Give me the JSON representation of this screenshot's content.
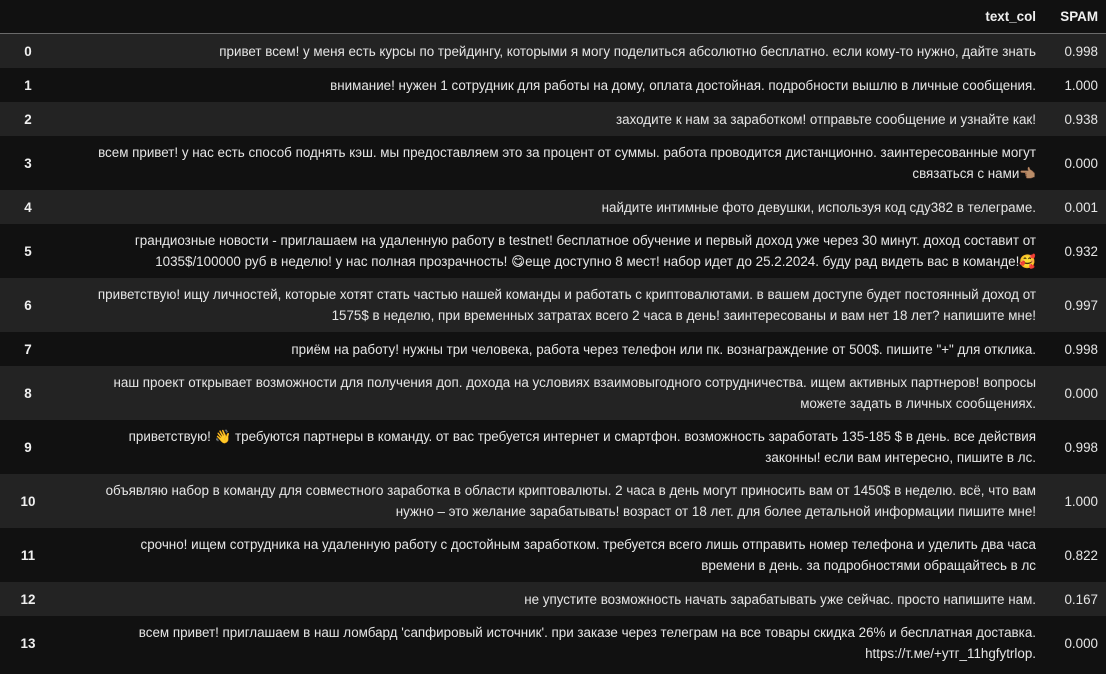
{
  "table": {
    "columns": [
      "",
      "text_col",
      "SPAM"
    ],
    "rows": [
      {
        "index": "0",
        "text": "привет всем! у меня есть курсы по трейдингу, которыми я могу поделиться абсолютно бесплатно. если кому-то нужно, дайте знать",
        "spam": "0.998"
      },
      {
        "index": "1",
        "text": "внимание! нужен 1 сотрудник для работы на дому, оплата достойная. подробности вышлю в личные сообщения.",
        "spam": "1.000"
      },
      {
        "index": "2",
        "text": "заходите к нам за заработком! отправьте сообщение и узнайте как!",
        "spam": "0.938"
      },
      {
        "index": "3",
        "text": "всем привет! у нас есть способ поднять кэш. мы предоставляем это за процент от суммы. работа проводится дистанционно. заинтересованные могут связаться с нами👈🏽",
        "spam": "0.000"
      },
      {
        "index": "4",
        "text": "найдите интимные фото девушки, используя код сду382 в телеграме.",
        "spam": "0.001"
      },
      {
        "index": "5",
        "text": "грандиозные новости - приглашаем на удаленную работу в testnet! бесплатное обучение и первый доход уже через 30 минут. доход составит от 1035$/100000 руб в неделю! у нас полная прозрачность! 😋еще доступно 8 мест! набор идет до 25.2.2024. буду рад видеть вас в команде!🥰",
        "spam": "0.932"
      },
      {
        "index": "6",
        "text": "приветствую! ищу личностей, которые хотят стать частью нашей команды и работать с криптовалютами. в вашем доступе будет постоянный доход от 1575$ в неделю, при временных затратах всего 2 часа в день! заинтересованы и вам нет 18 лет? напишите мне!",
        "spam": "0.997"
      },
      {
        "index": "7",
        "text": "приём на работу! нужны три человека, работа через телефон или пк. вознаграждение от 500$. пишите \"+\" для отклика.",
        "spam": "0.998"
      },
      {
        "index": "8",
        "text": "наш проект открывает возможности для получения доп. дохода на условиях взаимовыгодного сотрудничества. ищем активных партнеров! вопросы можете задать в личных сообщениях.",
        "spam": "0.000"
      },
      {
        "index": "9",
        "text": "приветствую! 👋 требуются партнеры в команду. от вас требуется интернет и смартфон. возможность заработать 135-185 $ в день. все действия законны! если вам интересно, пишите в лс.",
        "spam": "0.998"
      },
      {
        "index": "10",
        "text": "объявляю набор в команду для совместного заработка в области криптовалюты. 2 часа в день могут приносить вам от 1450$ в неделю. всё, что вам нужно – это желание зарабатывать! возраст от 18 лет. для более детальной информации пишите мне!",
        "spam": "1.000"
      },
      {
        "index": "11",
        "text": "срочно! ищем сотрудника на удаленную работу с достойным заработком. требуется всего лишь отправить номер телефона и уделить два часа времени в день. за подробностями обращайтесь в лс",
        "spam": "0.822"
      },
      {
        "index": "12",
        "text": "не упустите возможность начать зарабатывать уже сейчас. просто напишите нам.",
        "spam": "0.167"
      },
      {
        "index": "13",
        "text": "всем привет! приглашаем в наш ломбард 'сапфировый источник'. при заказе через телеграм на все товары скидка 26% и бесплатная доставка. https://т.ме/+утг_11hgfytrlop.",
        "spam": "0.000"
      }
    ]
  }
}
